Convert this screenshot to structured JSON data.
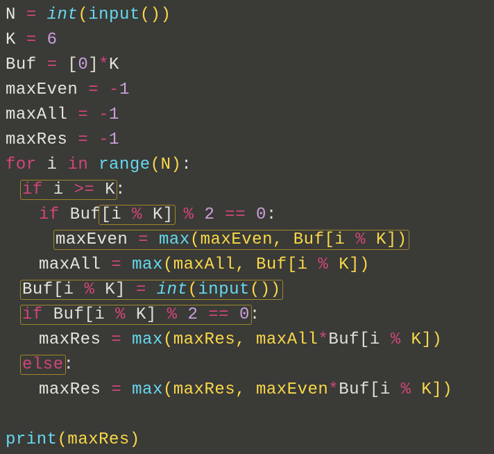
{
  "code": {
    "l1": {
      "a": "N ",
      "b": "=",
      "c": " ",
      "d": "int",
      "e": "(",
      "f": "input",
      "g": "()",
      ")": ")"
    },
    "l2": {
      "a": "K ",
      "b": "=",
      "c": " ",
      "d": "6"
    },
    "l3": {
      "a": "Buf ",
      "b": "=",
      "c": " [",
      "d": "0",
      "e": "]",
      "f": "*",
      "g": "K"
    },
    "l4": {
      "a": "maxEven ",
      "b": "=",
      "c": " -",
      "d": "1"
    },
    "l5": {
      "a": "maxAll ",
      "b": "=",
      "c": " -",
      "d": "1"
    },
    "l6": {
      "a": "maxRes ",
      "b": "=",
      "c": " -",
      "d": "1"
    },
    "l7": {
      "a": "for",
      "b": " i ",
      "c": "in",
      "d": " ",
      "e": "range",
      "f": "(N)",
      ":": ":"
    },
    "l8": {
      "a": "if",
      "b": " i ",
      "c": ">=",
      "d": " K",
      ":": ":"
    },
    "l9": {
      "a": "if",
      "b": " Buf",
      "c": "[",
      "d": "i ",
      "e": "%",
      "f": " K",
      "g": "]",
      "h": " ",
      "i": "%",
      "j": " ",
      "k": "2",
      "l": " ",
      "m": "==",
      "n": " ",
      "o": "0",
      "p": ":"
    },
    "l10": {
      "a": "maxEven ",
      "b": "=",
      "c": " ",
      "d": "max",
      "e": "(maxEven, Buf[i ",
      "f": "%",
      "g": " K])"
    },
    "l11": {
      "a": "maxAll ",
      "b": "=",
      "c": " ",
      "d": "max",
      "e": "(maxAll, Buf[i ",
      "f": "%",
      "g": " K])"
    },
    "l12": {
      "a": "Buf",
      "b": "[",
      "c": "i ",
      "d": "%",
      "e": " K",
      "f": "]",
      "g": " ",
      "h": "=",
      "i": " ",
      "j": "int",
      "k": "(",
      "l": "input",
      "m": "())"
    },
    "l13": {
      "a": "if",
      "b": " Buf[i ",
      "c": "%",
      "d": " K] ",
      "e": "%",
      "f": " ",
      "g": "2",
      "h": " ",
      "i": "==",
      "j": " ",
      "k": "0",
      "l": ":"
    },
    "l14": {
      "a": "maxRes ",
      "b": "=",
      "c": " ",
      "d": "max",
      "e": "(maxRes, maxAll",
      "f": "*",
      "g": "Buf[i ",
      "h": "%",
      "i": " K])"
    },
    "l15": {
      "a": "else",
      "b": ":"
    },
    "l16": {
      "a": "maxRes ",
      "b": "=",
      "c": " ",
      "d": "max",
      "e": "(maxRes, maxEven",
      "f": "*",
      "g": "Buf[i ",
      "h": "%",
      "i": " K])"
    },
    "l17": {
      "a": "print",
      "b": "(maxRes)"
    }
  }
}
